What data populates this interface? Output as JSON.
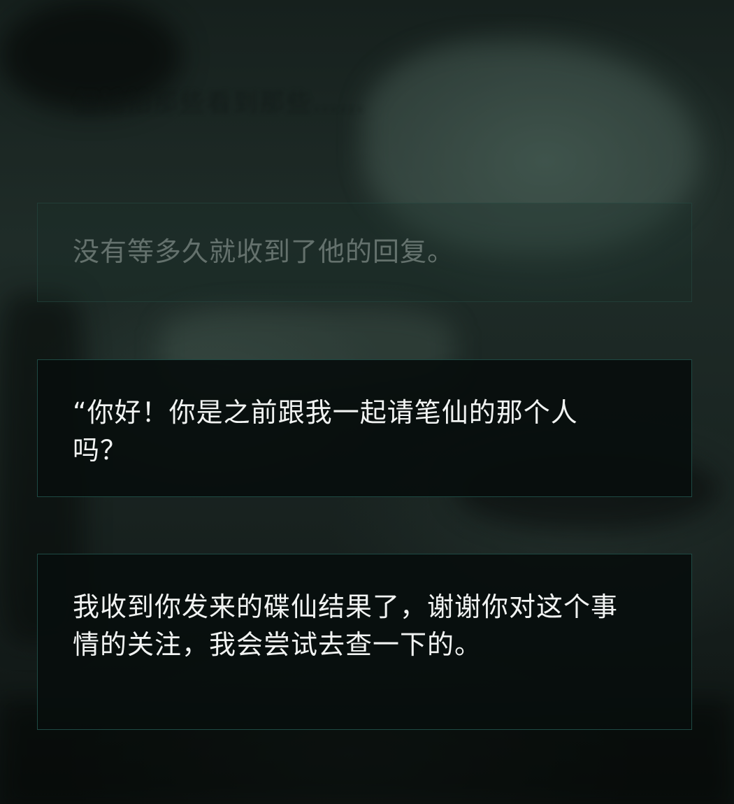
{
  "scene": {
    "background_color": "#0c1513",
    "box_border_color": "#1e4a44",
    "text_color": "#f1f3f2"
  },
  "ghost_line": "但她拍那些看到那些……",
  "dialogue": [
    {
      "text": "没有等多久就收到了他的回复。",
      "state": "faded"
    },
    {
      "text": "“你好！你是之前跟我一起请笔仙的那个人吗？",
      "state": "active"
    },
    {
      "text": "我收到你发来的碟仙结果了，谢谢你对这个事情的关注，我会尝试去查一下的。",
      "state": "active"
    }
  ]
}
